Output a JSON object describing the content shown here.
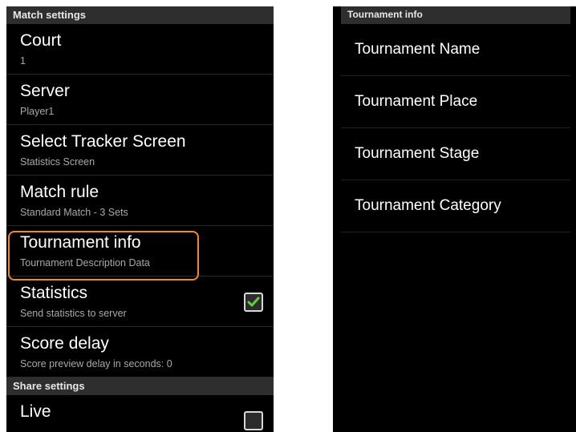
{
  "left": {
    "match_header": "Match settings",
    "items": [
      {
        "title": "Court",
        "summary": "1"
      },
      {
        "title": "Server",
        "summary": "Player1"
      },
      {
        "title": "Select Tracker Screen",
        "summary": "Statistics Screen"
      },
      {
        "title": "Match rule",
        "summary": "Standard Match - 3 Sets"
      },
      {
        "title": "Tournament info",
        "summary": "Tournament Description Data"
      },
      {
        "title": "Statistics",
        "summary": "Send statistics to server",
        "checked": true
      },
      {
        "title": "Score delay",
        "summary": "Score preview delay in seconds: 0"
      }
    ],
    "share_header": "Share settings",
    "partial_item": {
      "title": "Live"
    }
  },
  "right": {
    "header": "Tournament info",
    "items": [
      {
        "label": "Tournament Name"
      },
      {
        "label": "Tournament Place"
      },
      {
        "label": "Tournament Stage"
      },
      {
        "label": "Tournament Category"
      }
    ]
  },
  "colors": {
    "highlight": "#f08a24",
    "checkmark": "#5fd13a",
    "header_bg": "#2e2e2e"
  }
}
